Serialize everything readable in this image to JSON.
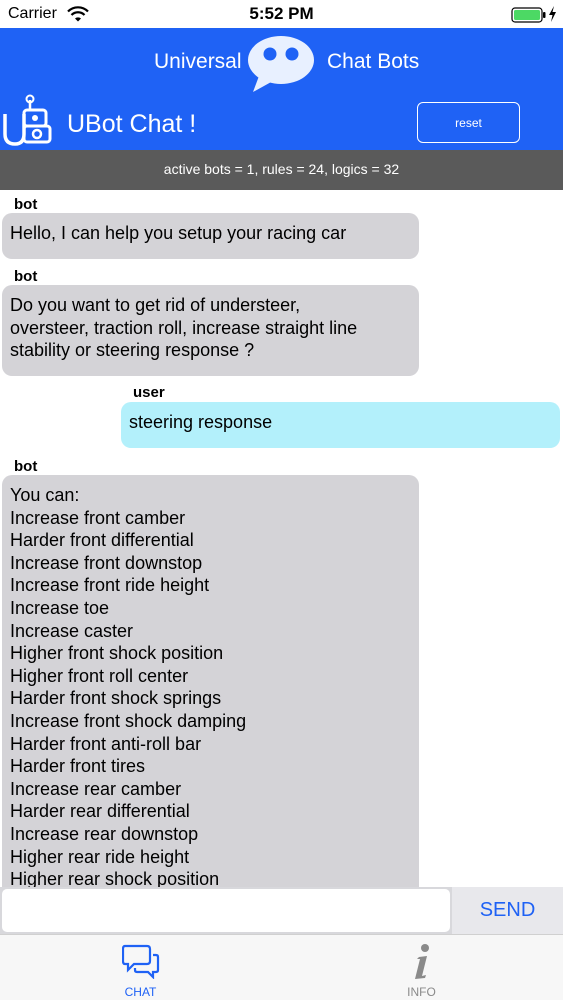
{
  "status_bar": {
    "carrier": "Carrier",
    "time": "5:52 PM",
    "battery_color": "#4cd964"
  },
  "header": {
    "brand_left": "Universal",
    "brand_right": "Chat Bots",
    "title": "UBot Chat !",
    "reset_label": "reset",
    "background": "#1f62f5"
  },
  "stats": {
    "text": "active bots = 1, rules = 24, logics = 32"
  },
  "messages": [
    {
      "sender": "bot",
      "text": "Hello, I can help you setup your racing car"
    },
    {
      "sender": "bot",
      "text": "Do you want to get rid of understeer,\noversteer, traction roll, increase straight line\nstability or steering response ?"
    },
    {
      "sender": "user",
      "text": "steering response"
    },
    {
      "sender": "bot",
      "text": "You can:\nIncrease front camber\nHarder front differential\nIncrease front downstop\nIncrease front ride height\nIncrease toe\nIncrease caster\nHigher front shock position\nHigher front roll center\nHarder front shock springs\nIncrease front shock damping\nHarder front anti-roll bar\nHarder front tires\nIncrease rear camber\nHarder rear differential\nIncrease rear downstop\nHigher rear ride height\nHigher rear shock position"
    }
  ],
  "input": {
    "value": "",
    "send_label": "SEND"
  },
  "tabs": [
    {
      "label": "CHAT",
      "icon": "chat-bubbles-icon",
      "active": true
    },
    {
      "label": "INFO",
      "icon": "info-icon",
      "active": false
    }
  ]
}
